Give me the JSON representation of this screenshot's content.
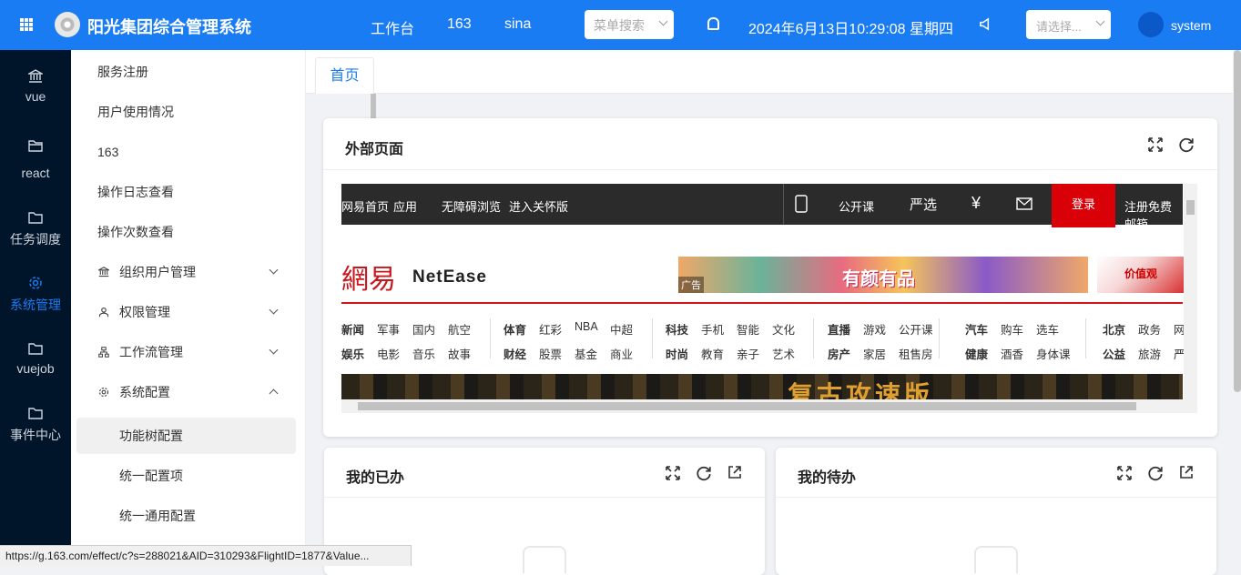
{
  "header": {
    "app_title": "阳光集团综合管理系统",
    "nav": [
      "工作台",
      "163",
      "sina"
    ],
    "search_placeholder": "菜单搜索",
    "datetime": "2024年6月13日10:29:08 星期四",
    "select_placeholder": "请选择...",
    "username": "system",
    "colors": {
      "primary": "#1a7cf3"
    }
  },
  "leftbar": {
    "items": [
      {
        "label": "vue",
        "icon": "bank-icon",
        "active": false
      },
      {
        "label": "react",
        "icon": "folder-icon",
        "active": false
      },
      {
        "label": "任务调度",
        "icon": "folder-icon",
        "active": false
      },
      {
        "label": "系统管理",
        "icon": "gear-icon",
        "active": true
      },
      {
        "label": "vuejob",
        "icon": "folder-icon",
        "active": false
      },
      {
        "label": "事件中心",
        "icon": "folder-icon",
        "active": false
      }
    ]
  },
  "submenu": {
    "items": [
      {
        "label": "服务注册"
      },
      {
        "label": "用户使用情况"
      },
      {
        "label": "163"
      },
      {
        "label": "操作日志查看"
      },
      {
        "label": "操作次数查看"
      },
      {
        "label": "组织用户管理",
        "icon": "bank-icon",
        "expandable": true
      },
      {
        "label": "权限管理",
        "icon": "user-icon",
        "expandable": true
      },
      {
        "label": "工作流管理",
        "icon": "flow-icon",
        "expandable": true
      },
      {
        "label": "系统配置",
        "icon": "gear-icon",
        "expandable": true,
        "expanded": true
      },
      {
        "label": "功能树配置",
        "selected": true
      },
      {
        "label": "统一配置项"
      },
      {
        "label": "统一通用配置"
      }
    ]
  },
  "tabs": [
    {
      "label": "首页"
    }
  ],
  "cards": {
    "external": {
      "title": "外部页面"
    },
    "done": {
      "title": "我的已办"
    },
    "todo": {
      "title": "我的待办"
    }
  },
  "netease": {
    "top_links": [
      "网易首页",
      "应用",
      "无障碍浏览",
      "进入关怀版",
      "公开课",
      "严选",
      "登录",
      "注册免费邮箱"
    ],
    "logo_cn": "網易",
    "logo_en": "NetEase",
    "ad_text": "有颜有品",
    "ad_tag": "广告",
    "ad2_text": "价值观",
    "nav_rows": [
      [
        "新闻",
        "军事",
        "国内",
        "航空",
        "体育",
        "红彩",
        "NBA",
        "中超",
        "科技",
        "手机",
        "智能",
        "文化",
        "直播",
        "游戏",
        "公开课",
        "汽车",
        "购车",
        "选车",
        "北京",
        "政务",
        "网"
      ],
      [
        "娱乐",
        "电影",
        "音乐",
        "故事",
        "财经",
        "股票",
        "基金",
        "商业",
        "时尚",
        "教育",
        "亲子",
        "艺术",
        "房产",
        "家居",
        "租售房",
        "健康",
        "酒香",
        "身体课",
        "公益",
        "旅游",
        "严"
      ]
    ],
    "banner_text": "复古攻速版"
  },
  "statusbar": {
    "url": "https://g.163.com/effect/c?s=288021&AID=310293&FlightID=1877&Value..."
  }
}
